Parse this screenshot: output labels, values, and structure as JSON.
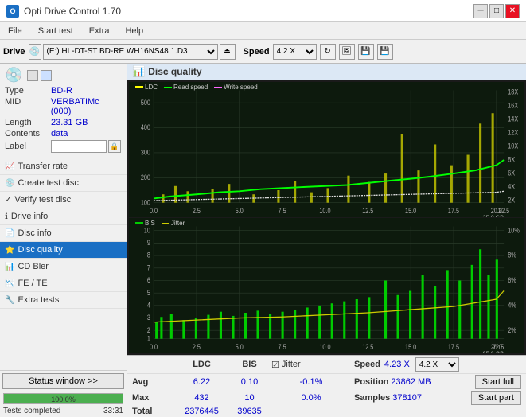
{
  "app": {
    "title": "Opti Drive Control 1.70",
    "icon": "O"
  },
  "titlebar": {
    "minimize": "─",
    "maximize": "□",
    "close": "✕"
  },
  "menu": {
    "items": [
      "File",
      "Start test",
      "Extra",
      "Help"
    ]
  },
  "toolbar": {
    "drive_label": "Drive",
    "drive_value": "(E:)  HL-DT-ST BD-RE  WH16NS48 1.D3",
    "speed_label": "Speed",
    "speed_value": "4.2 X"
  },
  "disc": {
    "header_icon": "💿",
    "type_label": "Type",
    "type_value": "BD-R",
    "mid_label": "MID",
    "mid_value": "VERBATIMc (000)",
    "length_label": "Length",
    "length_value": "23.31 GB",
    "contents_label": "Contents",
    "contents_value": "data",
    "label_label": "Label",
    "label_value": ""
  },
  "nav": {
    "items": [
      {
        "label": "Transfer rate",
        "icon": "📈",
        "active": false
      },
      {
        "label": "Create test disc",
        "icon": "💿",
        "active": false
      },
      {
        "label": "Verify test disc",
        "icon": "✓",
        "active": false
      },
      {
        "label": "Drive info",
        "icon": "ℹ",
        "active": false
      },
      {
        "label": "Disc info",
        "icon": "📄",
        "active": false
      },
      {
        "label": "Disc quality",
        "icon": "⭐",
        "active": true
      },
      {
        "label": "CD Bler",
        "icon": "📊",
        "active": false
      },
      {
        "label": "FE / TE",
        "icon": "📉",
        "active": false
      },
      {
        "label": "Extra tests",
        "icon": "🔧",
        "active": false
      }
    ]
  },
  "chart": {
    "title": "Disc quality",
    "icon": "📊",
    "top_legend": {
      "ldc": "LDC",
      "read": "Read speed",
      "write": "Write speed"
    },
    "bottom_legend": {
      "bis": "BIS",
      "jitter": "Jitter"
    },
    "top_yaxis": [
      "500",
      "400",
      "300",
      "200",
      "100"
    ],
    "top_yaxis_right": [
      "18X",
      "16X",
      "14X",
      "12X",
      "10X",
      "8X",
      "6X",
      "4X",
      "2X"
    ],
    "bottom_yaxis": [
      "10",
      "9",
      "8",
      "7",
      "6",
      "5",
      "4",
      "3",
      "2",
      "1"
    ],
    "bottom_yaxis_right": [
      "10%",
      "8%",
      "6%",
      "4%",
      "2%"
    ],
    "xaxis": [
      "0.0",
      "2.5",
      "5.0",
      "7.5",
      "10.0",
      "12.5",
      "15.0",
      "17.5",
      "20.0",
      "22.5",
      "25.0 GB"
    ]
  },
  "stats": {
    "ldc_header": "LDC",
    "bis_header": "BIS",
    "jitter_header": "Jitter",
    "speed_header": "Speed",
    "position_header": "Position",
    "samples_header": "Samples",
    "avg_label": "Avg",
    "max_label": "Max",
    "total_label": "Total",
    "ldc_avg": "6.22",
    "ldc_max": "432",
    "ldc_total": "2376445",
    "bis_avg": "0.10",
    "bis_max": "10",
    "bis_total": "39635",
    "jitter_check": "✓",
    "jitter_label": "Jitter",
    "jitter_avg": "-0.1%",
    "jitter_max": "0.0%",
    "jitter_total": "",
    "speed_value": "4.23 X",
    "speed_label2": "4.2 X",
    "position_value": "23862 MB",
    "samples_value": "378107"
  },
  "buttons": {
    "start_full": "Start full",
    "start_part": "Start part",
    "status_window": "Status window >>"
  },
  "status": {
    "text": "Tests completed",
    "progress": 100,
    "time": "33:31"
  }
}
